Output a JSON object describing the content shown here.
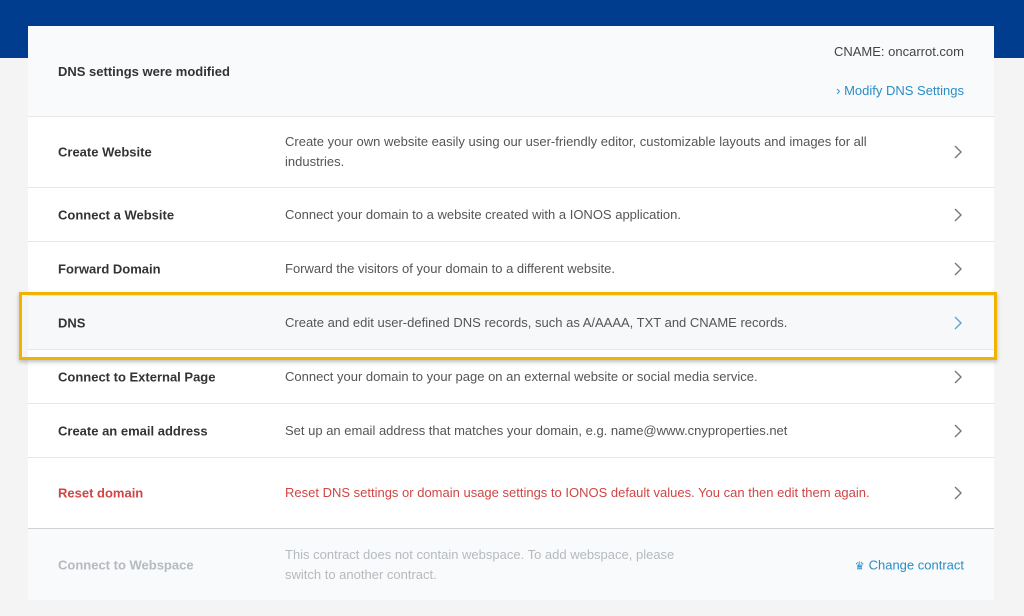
{
  "status": {
    "title": "DNS settings were modified",
    "cname": "CNAME: oncarrot.com",
    "modify_link": "Modify DNS Settings"
  },
  "options": [
    {
      "title": "Create Website",
      "desc": "Create your own website easily using our user-friendly editor, customizable layouts and images for all industries."
    },
    {
      "title": "Connect a Website",
      "desc": "Connect your domain to a website created with a IONOS application."
    },
    {
      "title": "Forward Domain",
      "desc": "Forward the visitors of your domain to a different website."
    },
    {
      "title": "DNS",
      "desc": "Create and edit user-defined DNS records, such as A/AAAA, TXT and CNAME records."
    },
    {
      "title": "Connect to External Page",
      "desc": "Connect your domain to your page on an external website or social media service."
    },
    {
      "title": "Create an email address",
      "desc": "Set up an email address that matches your domain, e.g. name@www.cnyproperties.net"
    },
    {
      "title": "Reset domain",
      "desc": "Reset DNS settings or domain usage settings to IONOS default values. You can then edit them again."
    }
  ],
  "webspace": {
    "title": "Connect to Webspace",
    "desc": "This contract does not contain webspace. To add webspace, please switch to another contract.",
    "change_link": "Change contract"
  },
  "colors": {
    "header": "#003d8f",
    "link": "#2a8dc7",
    "danger": "#d04545",
    "highlight": "#f0b400"
  },
  "icons": {
    "row_arrow": "chevron-right-icon",
    "modify_arrow": "chevron-right-icon",
    "change_contract": "crown-icon"
  }
}
